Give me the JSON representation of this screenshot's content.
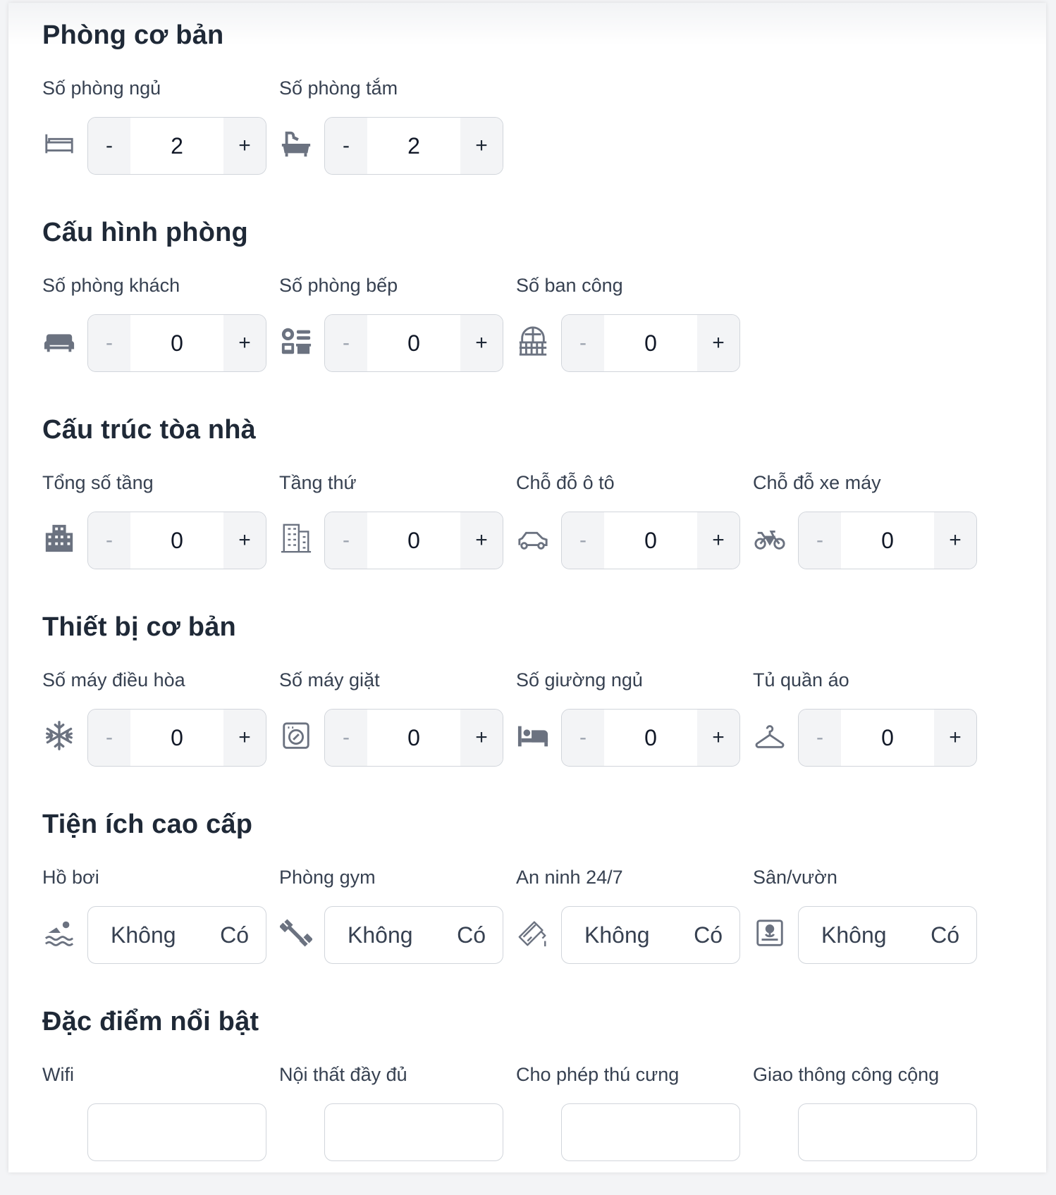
{
  "sections": [
    {
      "title": "Phòng cơ bản",
      "fields": [
        {
          "label": "Số phòng ngủ",
          "icon": "bed-frame-icon",
          "value": "2"
        },
        {
          "label": "Số phòng tắm",
          "icon": "bathtub-icon",
          "value": "2"
        }
      ]
    },
    {
      "title": "Cấu hình phòng",
      "fields": [
        {
          "label": "Số phòng khách",
          "icon": "sofa-icon",
          "value": "0"
        },
        {
          "label": "Số phòng bếp",
          "icon": "kitchen-icon",
          "value": "0"
        },
        {
          "label": "Số ban công",
          "icon": "balcony-icon",
          "value": "0"
        }
      ]
    },
    {
      "title": "Cấu trúc tòa nhà",
      "fields": [
        {
          "label": "Tổng số tầng",
          "icon": "building-icon",
          "value": "0"
        },
        {
          "label": "Tầng thứ",
          "icon": "office-building-icon",
          "value": "0"
        },
        {
          "label": "Chỗ đỗ ô tô",
          "icon": "car-icon",
          "value": "0"
        },
        {
          "label": "Chỗ đỗ xe máy",
          "icon": "motorbike-icon",
          "value": "0"
        }
      ]
    },
    {
      "title": "Thiết bị cơ bản",
      "fields": [
        {
          "label": "Số máy điều hòa",
          "icon": "snowflake-icon",
          "value": "0"
        },
        {
          "label": "Số máy giặt",
          "icon": "washing-machine-icon",
          "value": "0"
        },
        {
          "label": "Số giường ngủ",
          "icon": "bed-icon",
          "value": "0"
        },
        {
          "label": "Tủ quần áo",
          "icon": "hanger-icon",
          "value": "0"
        }
      ]
    },
    {
      "title": "Tiện ích cao cấp",
      "fields": [
        {
          "label": "Hồ bơi",
          "icon": "swimmer-icon",
          "no": "Không",
          "yes": "Có"
        },
        {
          "label": "Phòng gym",
          "icon": "dumbbell-icon",
          "no": "Không",
          "yes": "Có"
        },
        {
          "label": "An ninh 24/7",
          "icon": "security-camera-icon",
          "no": "Không",
          "yes": "Có"
        },
        {
          "label": "Sân/vườn",
          "icon": "garden-icon",
          "no": "Không",
          "yes": "Có"
        }
      ]
    },
    {
      "title": "Đặc điểm nổi bật",
      "fields": [
        {
          "label": "Wifi"
        },
        {
          "label": "Nội thất đầy đủ"
        },
        {
          "label": "Cho phép thú cưng"
        },
        {
          "label": "Giao thông công cộng"
        }
      ]
    }
  ],
  "stepper": {
    "minus": "-",
    "plus": "+"
  }
}
